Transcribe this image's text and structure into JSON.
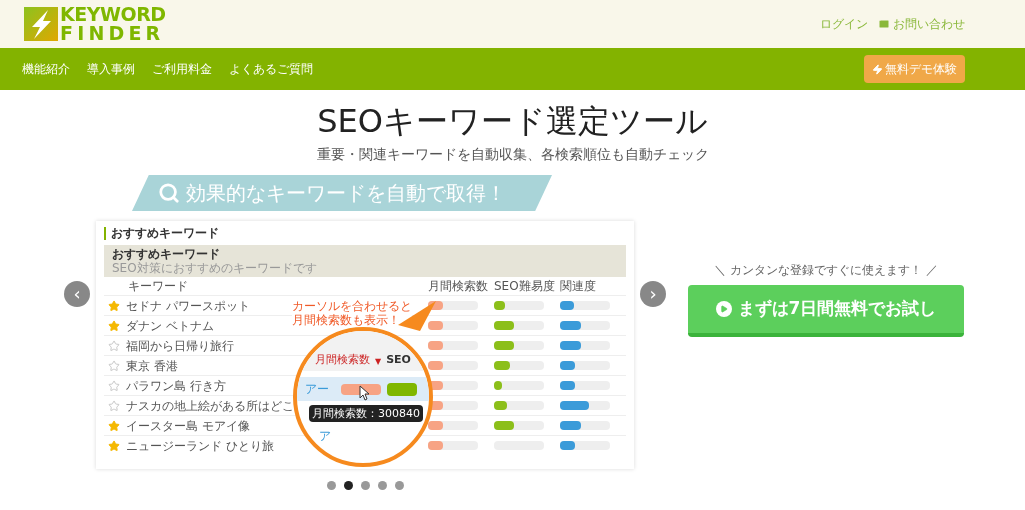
{
  "header": {
    "logo": [
      "KEYWORD",
      "FINDER"
    ],
    "links": [
      {
        "kind": "plain",
        "label": "ログイン"
      },
      {
        "kind": "mail",
        "label": "お問い合わせ"
      }
    ]
  },
  "nav": {
    "items": [
      "機能紹介",
      "導入事例",
      "ご利用料金",
      "よくあるご質問"
    ],
    "demo_button": "無料デモ体験"
  },
  "hero": {
    "title": "SEOキーワード選定ツール",
    "subtitle": "重要・関連キーワードを自動収集、各検索順位も自動チェック"
  },
  "banner": "効果的なキーワードを自動で取得！",
  "slide": {
    "section_title": "おすすめキーワード",
    "card_title": "おすすめキーワード",
    "card_subtitle": "SEO対策におすすめのキーワードです",
    "columns": [
      "キーワード",
      "月間検索数",
      "SEO難易度",
      "関連度"
    ],
    "rows": [
      {
        "keyword": "セドナ パワースポット",
        "starred": true,
        "volume": {
          "level": 0.3
        },
        "seo": {
          "level": 0.22
        },
        "relevance": {
          "level": 0.28
        }
      },
      {
        "keyword": "ダナン ベトナム",
        "starred": true,
        "volume": {
          "level": 0.3
        },
        "seo": {
          "level": 0.4
        },
        "relevance": {
          "level": 0.42
        }
      },
      {
        "keyword": "福岡から日帰り旅行",
        "starred": false,
        "volume": {
          "level": 0.3
        },
        "seo": {
          "level": 0.4
        },
        "relevance": {
          "level": 0.42
        }
      },
      {
        "keyword": "東京 香港",
        "starred": false,
        "volume": {
          "level": 0.3
        },
        "seo": {
          "level": 0.32
        },
        "relevance": {
          "level": 0.3
        }
      },
      {
        "keyword": "パラワン島 行き方",
        "starred": false,
        "volume": {
          "level": 0.3
        },
        "seo": {
          "level": 0.15
        },
        "relevance": {
          "level": 0.3
        }
      },
      {
        "keyword": "ナスカの地上絵がある所はどこ",
        "starred": false,
        "volume": {
          "level": 0.3
        },
        "seo": {
          "level": 0.25
        },
        "relevance": {
          "level": 0.57
        }
      },
      {
        "keyword": "イースター島 モアイ像",
        "starred": true,
        "volume": {
          "level": 0.3
        },
        "seo": {
          "level": 0.4
        },
        "relevance": {
          "level": 0.42
        }
      },
      {
        "keyword": "ニュージーランド ひとり旅",
        "starred": true,
        "volume": {
          "level": 0.3
        },
        "relevance": {
          "level": 0.3
        }
      }
    ],
    "callout": [
      "カーソルを合わせると",
      "月間検索数も表示！"
    ],
    "magnifier": {
      "header_label": "月間検索数",
      "sort_mark": "▼",
      "header_next": "SEO",
      "row_fragment": "アー",
      "next_row_fragment": "ア",
      "tooltip": "月間検索数：300840"
    }
  },
  "carousel": {
    "prev": "‹",
    "next": "›",
    "dots": [
      {
        "selected": false
      },
      {
        "selected": true
      },
      {
        "selected": false
      },
      {
        "selected": false
      },
      {
        "selected": false
      }
    ]
  },
  "cta": {
    "caption": "＼ カンタンな登録ですぐに使えます！ ／",
    "button": "まずは7日間無料でお試し"
  }
}
